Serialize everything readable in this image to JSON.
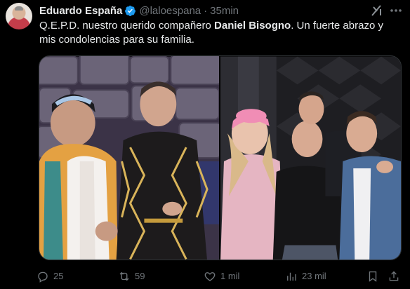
{
  "author": {
    "name": "Eduardo España",
    "handle": "@laloespana",
    "separator": "·",
    "time": "35min"
  },
  "tweet": {
    "text_before": "Q.E.P.D. nuestro querido compañero ",
    "text_bold": "Daniel Bisogno",
    "text_after": ". Un fuerte abrazo y mis condolencias para su familia."
  },
  "media": {
    "images": [
      "stage-photo",
      "studio-group-photo"
    ]
  },
  "actions": {
    "replies": "25",
    "reposts": "59",
    "likes": "1 mil",
    "views": "23 mil"
  },
  "colors": {
    "background": "#000000",
    "text": "#e7e9ea",
    "muted": "#71767b",
    "verified": "#1d9bf0",
    "border": "#2f3336"
  },
  "icons": [
    "verified-badge-icon",
    "grok-icon",
    "more-options-icon",
    "reply-icon",
    "repost-icon",
    "like-icon",
    "views-icon",
    "bookmark-icon",
    "share-icon"
  ]
}
